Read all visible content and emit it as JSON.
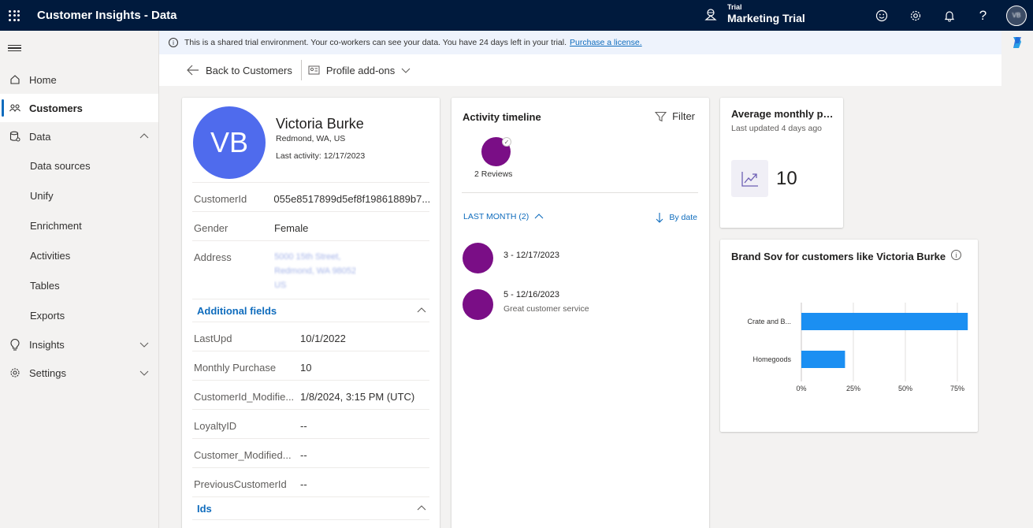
{
  "topbar": {
    "app_title": "Customer Insights - Data",
    "env_small": "Trial",
    "env_name": "Marketing Trial",
    "avatar_initials": "VB"
  },
  "banner": {
    "text": "This is a shared trial environment. Your co-workers can see your data. You have 24 days left in your trial.",
    "link": "Purchase a license."
  },
  "sidebar": {
    "home": "Home",
    "customers": "Customers",
    "data": "Data",
    "data_items": [
      "Data sources",
      "Unify",
      "Enrichment",
      "Activities",
      "Tables",
      "Exports"
    ],
    "insights": "Insights",
    "settings": "Settings"
  },
  "cmdbar": {
    "back": "Back to Customers",
    "addons": "Profile add-ons"
  },
  "profile": {
    "initials": "VB",
    "name": "Victoria Burke",
    "location": "Redmond, WA, US",
    "last_activity": "Last activity: 12/17/2023",
    "fields": [
      {
        "k": "CustomerId",
        "v": "055e8517899d5ef8f19861889b7..."
      },
      {
        "k": "Gender",
        "v": "Female"
      }
    ],
    "address_label": "Address",
    "address_lines": [
      "5000 15th Street,",
      "Redmond, WA 98052",
      "US"
    ],
    "additional_label": "Additional fields",
    "additional": [
      {
        "k": "LastUpd",
        "v": "10/1/2022"
      },
      {
        "k": "Monthly Purchase",
        "v": "10"
      },
      {
        "k": "CustomerId_Modifie...",
        "v": "1/8/2024, 3:15 PM (UTC)"
      },
      {
        "k": "LoyaltyID",
        "v": "--"
      },
      {
        "k": "Customer_Modified...",
        "v": "--"
      },
      {
        "k": "PreviousCustomerId",
        "v": "--"
      }
    ],
    "ids_label": "Ids"
  },
  "timeline": {
    "title": "Activity timeline",
    "filter": "Filter",
    "bubble_label": "2 Reviews",
    "group": "LAST MONTH (2)",
    "sort": "By date",
    "items": [
      {
        "title": "3 - 12/17/2023",
        "sub": ""
      },
      {
        "title": "5 - 12/16/2023",
        "sub": "Great customer service"
      }
    ],
    "color": "#7a0e86"
  },
  "avg": {
    "title": "Average monthly pu...",
    "sub": "Last updated 4 days ago",
    "value": "10"
  },
  "brand": {
    "title": "Brand Sov for customers like Victoria Burke"
  },
  "chart_data": {
    "type": "bar",
    "orientation": "horizontal",
    "categories": [
      "Crate and B...",
      "Homegoods"
    ],
    "values": [
      80,
      21
    ],
    "xticks": [
      "0%",
      "25%",
      "50%",
      "75%"
    ],
    "xlim": [
      0,
      80
    ],
    "bar_color": "#1b8ff2"
  }
}
